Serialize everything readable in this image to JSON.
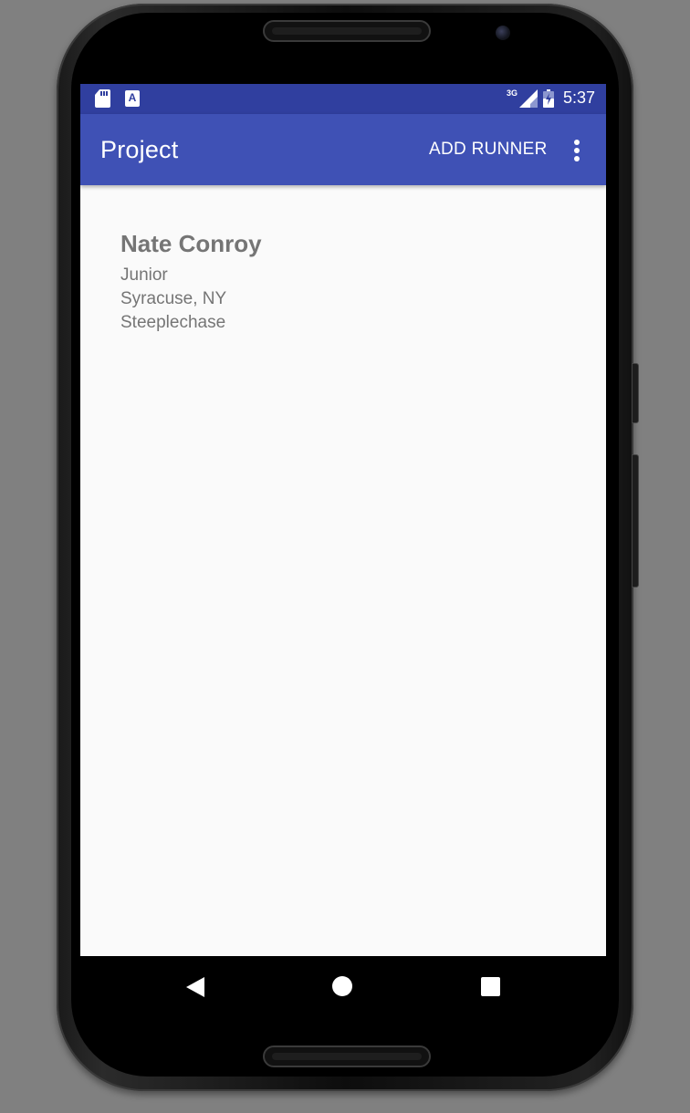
{
  "status_bar": {
    "left_icons": [
      "sd-card-icon",
      "a-notification-icon"
    ],
    "network_label": "3G",
    "time": "5:37",
    "right_icons": [
      "signal-icon",
      "battery-charging-icon"
    ],
    "color": "#303f9f"
  },
  "app_bar": {
    "title": "Project",
    "action_label": "ADD RUNNER",
    "overflow_icon": "more-vert-icon",
    "color": "#3f51b5"
  },
  "runners": [
    {
      "name": "Nate Conroy",
      "year": "Junior",
      "hometown": "Syracuse, NY",
      "event": "Steeplechase"
    }
  ],
  "nav_bar": {
    "buttons": [
      "back-icon",
      "home-icon",
      "recents-icon"
    ]
  }
}
